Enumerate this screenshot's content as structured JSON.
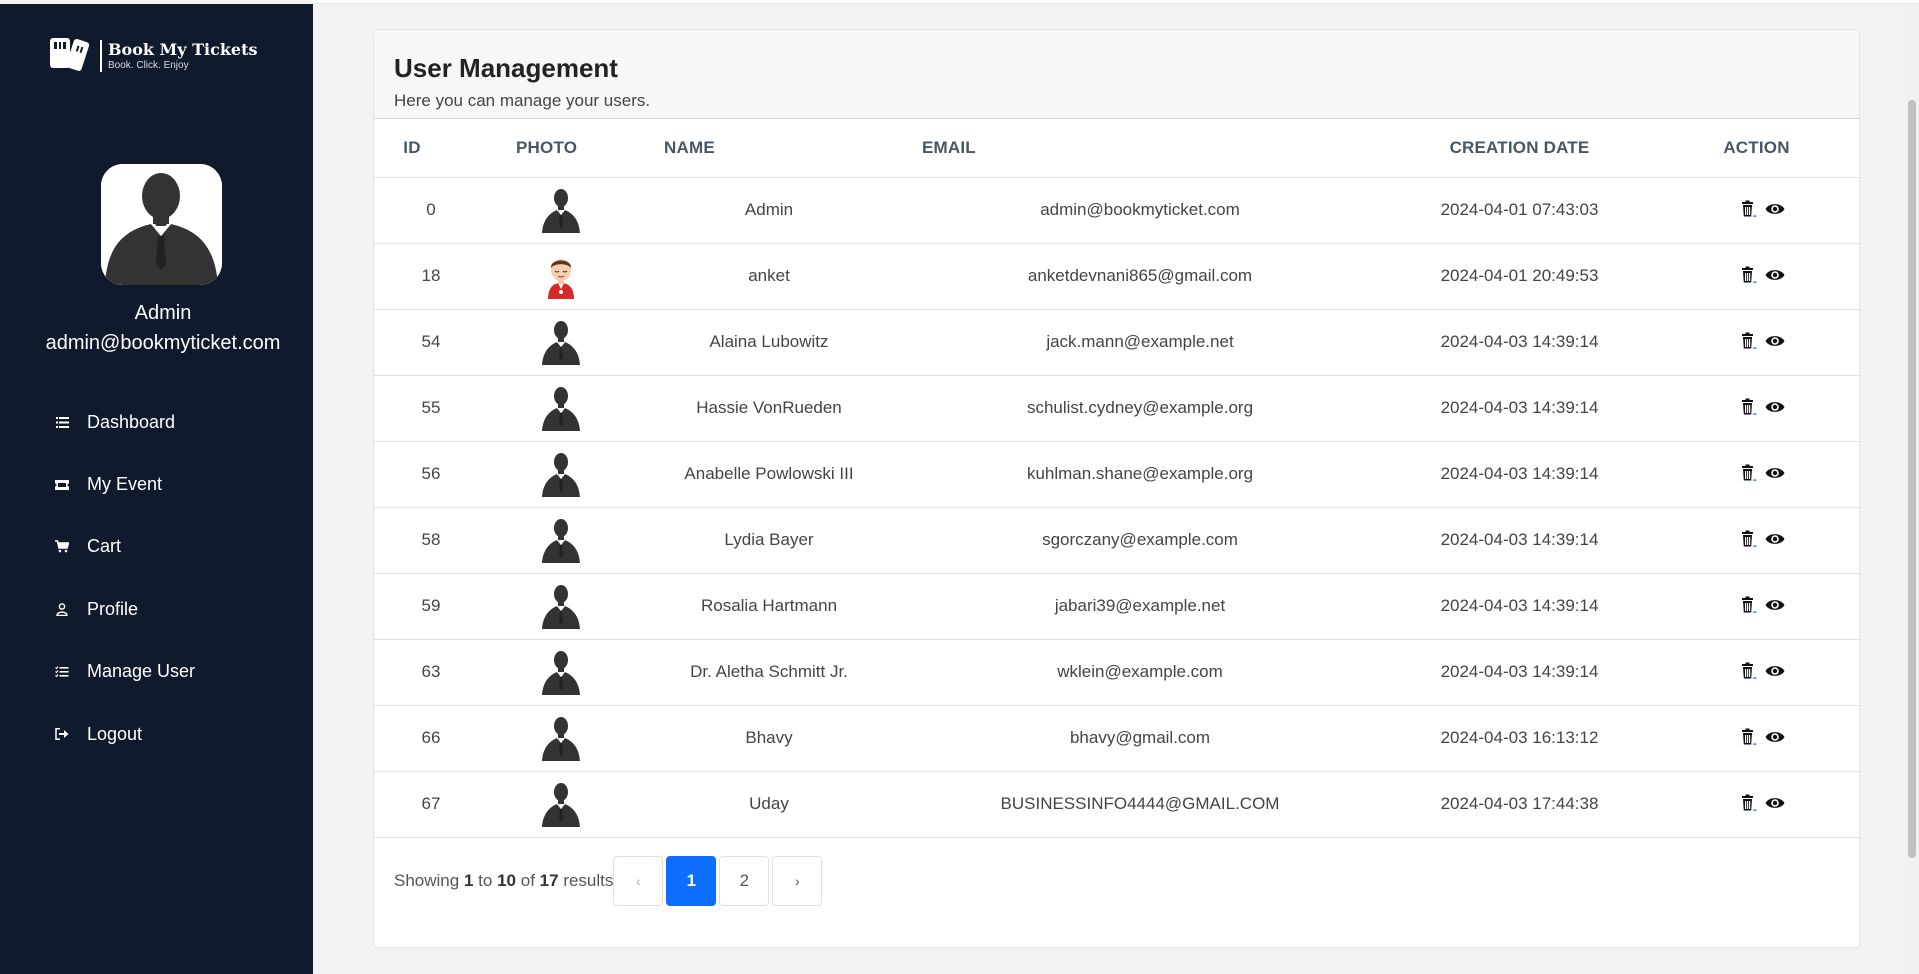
{
  "brand": {
    "name": "Book My Tickets",
    "tagline": "Book. Click. Enjoy"
  },
  "profile": {
    "name": "Admin",
    "email": "admin@bookmyticket.com"
  },
  "nav": [
    {
      "label": "Dashboard",
      "icon": "list-icon"
    },
    {
      "label": "My Event",
      "icon": "ticket-icon"
    },
    {
      "label": "Cart",
      "icon": "cart-icon"
    },
    {
      "label": "Profile",
      "icon": "person-icon"
    },
    {
      "label": "Manage User",
      "icon": "list-check-icon"
    },
    {
      "label": "Logout",
      "icon": "logout-icon"
    }
  ],
  "page": {
    "title": "User Management",
    "subtitle": "Here you can manage your users."
  },
  "table": {
    "headers": {
      "id": "ID",
      "photo": "PHOTO",
      "name": "NAME",
      "email": "EMAIL",
      "date": "CREATION DATE",
      "action": "ACTION"
    },
    "rows": [
      {
        "id": "0",
        "photo": "silhouette",
        "name": "Admin",
        "email": "admin@bookmyticket.com",
        "date": "2024-04-01 07:43:03"
      },
      {
        "id": "18",
        "photo": "cartoon",
        "name": "anket",
        "email": "anketdevnani865@gmail.com",
        "date": "2024-04-01 20:49:53"
      },
      {
        "id": "54",
        "photo": "silhouette",
        "name": "Alaina Lubowitz",
        "email": "jack.mann@example.net",
        "date": "2024-04-03 14:39:14"
      },
      {
        "id": "55",
        "photo": "silhouette",
        "name": "Hassie VonRueden",
        "email": "schulist.cydney@example.org",
        "date": "2024-04-03 14:39:14"
      },
      {
        "id": "56",
        "photo": "silhouette",
        "name": "Anabelle Powlowski III",
        "email": "kuhlman.shane@example.org",
        "date": "2024-04-03 14:39:14"
      },
      {
        "id": "58",
        "photo": "silhouette",
        "name": "Lydia Bayer",
        "email": "sgorczany@example.com",
        "date": "2024-04-03 14:39:14"
      },
      {
        "id": "59",
        "photo": "silhouette",
        "name": "Rosalia Hartmann",
        "email": "jabari39@example.net",
        "date": "2024-04-03 14:39:14"
      },
      {
        "id": "63",
        "photo": "silhouette",
        "name": "Dr. Aletha Schmitt Jr.",
        "email": "wklein@example.com",
        "date": "2024-04-03 14:39:14"
      },
      {
        "id": "66",
        "photo": "silhouette",
        "name": "Bhavy",
        "email": "bhavy@gmail.com",
        "date": "2024-04-03 16:13:12"
      },
      {
        "id": "67",
        "photo": "silhouette",
        "name": "Uday",
        "email": "BUSINESSINFO4444@GMAIL.COM",
        "date": "2024-04-03 17:44:38"
      }
    ],
    "row_icons": [
      "trash-icon",
      "eye-icon"
    ]
  },
  "pagination": {
    "showing_prefix": "Showing",
    "from": "1",
    "to_word": "to",
    "to": "10",
    "of_word": "of",
    "total": "17",
    "suffix": "results",
    "prev": "‹",
    "next": "›",
    "pages": [
      "1",
      "2"
    ],
    "current": "1"
  },
  "colors": {
    "sidebar_bg": "#101a2d",
    "accent": "#0d6efd",
    "page_bg": "#f3f3f4"
  }
}
